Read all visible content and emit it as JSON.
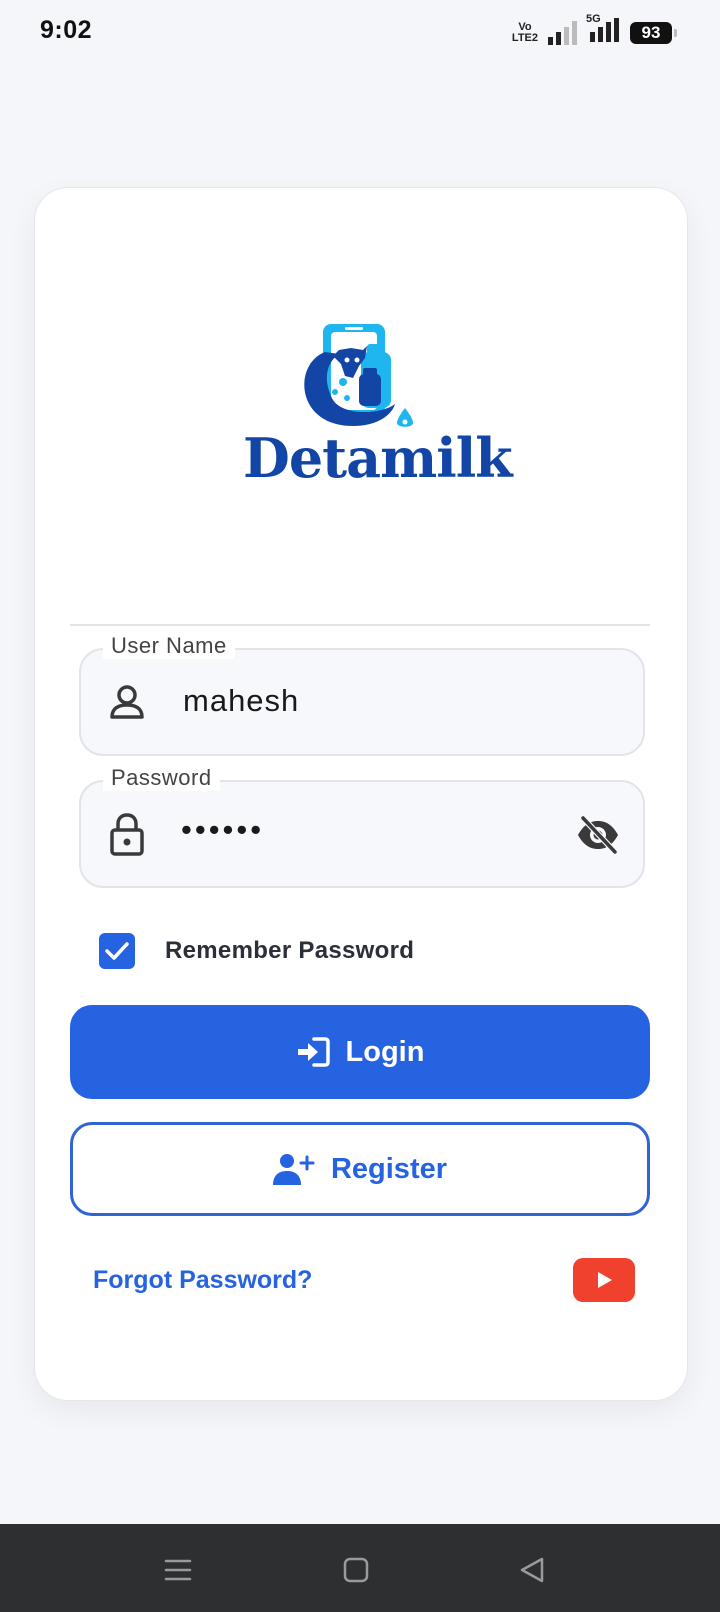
{
  "status_bar": {
    "time": "9:02",
    "network_top": "Vo",
    "network_bottom": "LTE2",
    "network_5g": "5G",
    "battery": "93"
  },
  "logo": {
    "brand_name": "Detamilk",
    "colors": {
      "dark_blue": "#1245a6",
      "light_blue": "#1fb6f0"
    }
  },
  "form": {
    "username": {
      "label": "User Name",
      "value": "mahesh",
      "icon": "user-icon"
    },
    "password": {
      "label": "Password",
      "value": "••••••",
      "icon": "lock-icon",
      "toggle_icon": "eye-off-icon"
    },
    "remember": {
      "label": "Remember Password",
      "checked": true
    }
  },
  "buttons": {
    "login": {
      "label": "Login",
      "icon": "login-icon",
      "color": "#2563e0"
    },
    "register": {
      "label": "Register",
      "icon": "user-plus-icon"
    }
  },
  "links": {
    "forgot_password": "Forgot Password?",
    "youtube_icon": "youtube-icon",
    "youtube_color": "#f0412e"
  },
  "nav": {
    "menu_icon": "menu-icon",
    "home_icon": "home-square-icon",
    "back_icon": "back-triangle-icon"
  }
}
